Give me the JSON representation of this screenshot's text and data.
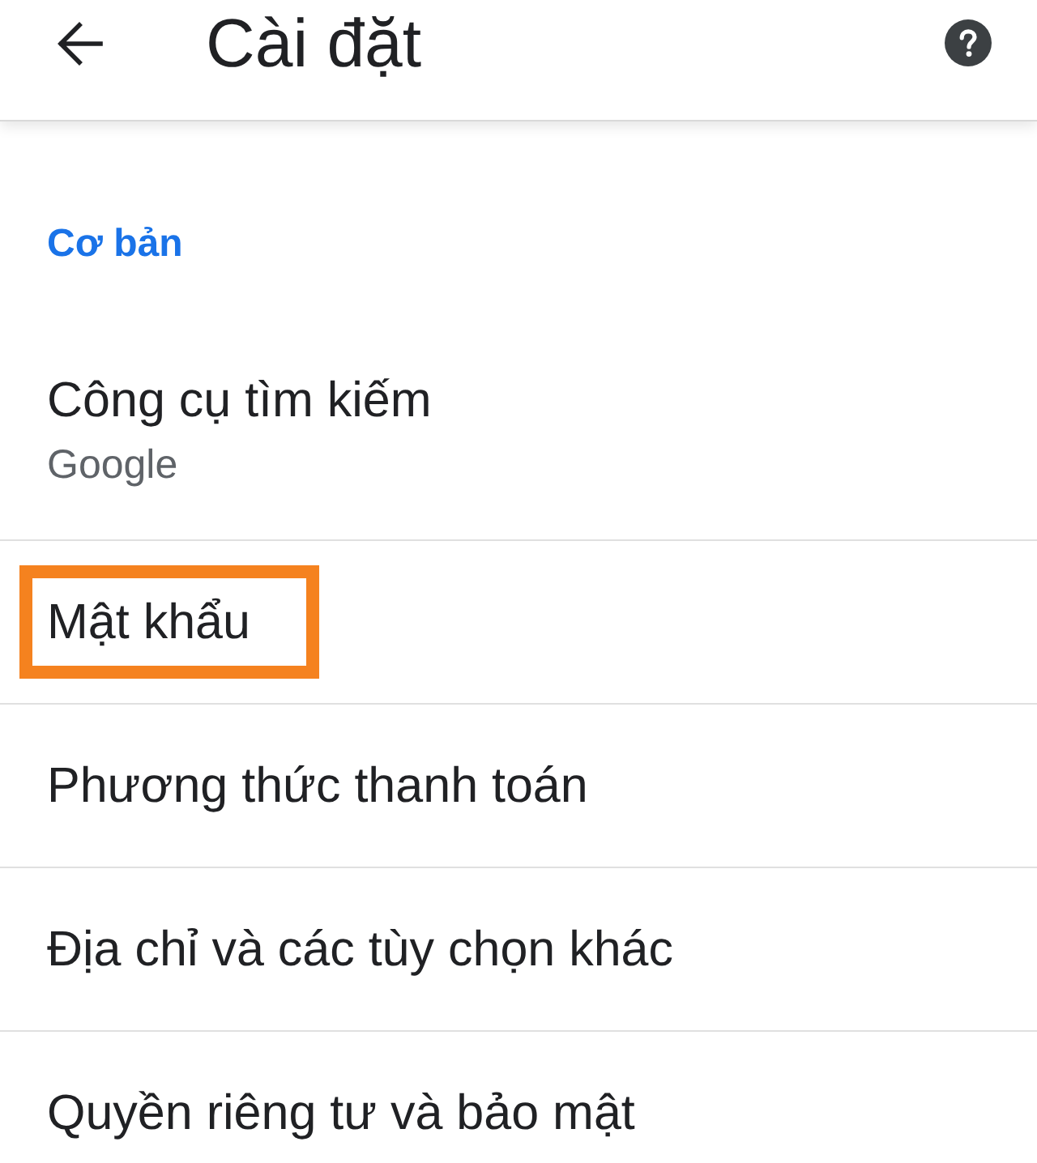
{
  "app_bar": {
    "title": "Cài đặt"
  },
  "section": {
    "title": "Cơ bản"
  },
  "items": [
    {
      "title": "Công cụ tìm kiếm",
      "subtitle": "Google",
      "highlighted": false
    },
    {
      "title": "Mật khẩu",
      "highlighted": true
    },
    {
      "title": "Phương thức thanh toán",
      "highlighted": false
    },
    {
      "title": "Địa chỉ và các tùy chọn khác",
      "highlighted": false
    },
    {
      "title": "Quyền riêng tư và bảo mật",
      "highlighted": false
    }
  ]
}
